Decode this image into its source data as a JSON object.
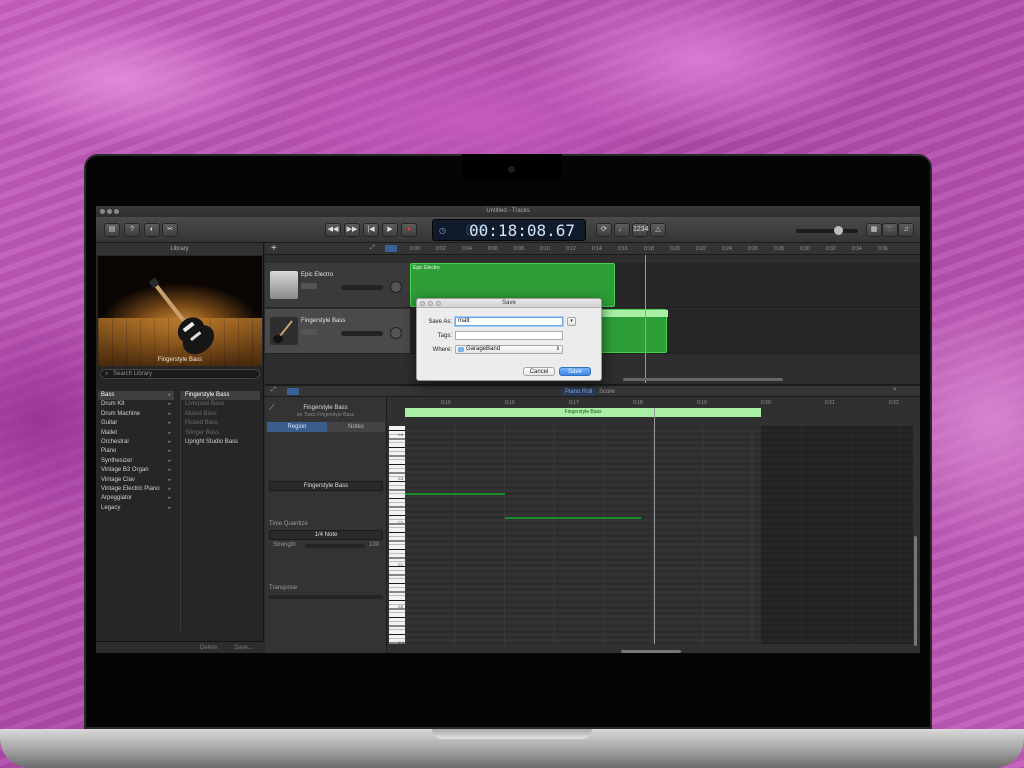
{
  "window": {
    "title": "Untitled - Tracks"
  },
  "transport": {
    "time": "00:18:08.67",
    "ghost": "00"
  },
  "library": {
    "header": "Library",
    "image_caption": "Fingerstyle Bass",
    "search_placeholder": "Search Library",
    "categories": [
      "Bass",
      "Drum Kit",
      "Drum Machine",
      "Guitar",
      "Mallet",
      "Orchestral",
      "Piano",
      "Synthesizer",
      "Vintage B3 Organ",
      "Vintage Clav",
      "Vintage Electric Piano",
      "Arpeggiator",
      "Legacy"
    ],
    "patches": [
      "Fingerstyle Bass",
      "Liverpool Bass",
      "Muted Bass",
      "Picked Bass",
      "Stinger Bass",
      "Upright Studio Bass"
    ],
    "footer_delete": "Delete",
    "footer_save": "Save..."
  },
  "ruler": [
    "0:00",
    "0:02",
    "0:04",
    "0:06",
    "0:08",
    "0:10",
    "0:12",
    "0:14",
    "0:16",
    "0:18",
    "0:20",
    "0:22",
    "0:24",
    "0:26",
    "0:28",
    "0:30",
    "0:32",
    "0:34",
    "0:36"
  ],
  "tracks": [
    {
      "name": "Epic Electro",
      "region": "Epic Electro"
    },
    {
      "name": "Fingerstyle Bass",
      "region": ""
    }
  ],
  "editor": {
    "tab_piano": "Piano Roll",
    "tab_score": "Score",
    "title": "Fingerstyle Bass",
    "subtitle": "on Track Fingerstyle Bass",
    "seg_region": "Region",
    "seg_notes": "Notes",
    "region_name": "Fingerstyle Bass",
    "time_quantize_label": "Time Quantize",
    "time_quantize_value": "1/4 Note",
    "strength_label": "Strength",
    "strength_value": "100",
    "transpose_label": "Transpose",
    "region_bar": "Fingerstyle Bass",
    "ruler": [
      "0:15",
      "0:16",
      "0:17",
      "0:18",
      "0:19",
      "0:20",
      "0:21",
      "0:22"
    ],
    "octaves": [
      "C4",
      "C3",
      "C2",
      "C1",
      "C0",
      "C-1"
    ]
  },
  "dialog": {
    "title": "Save",
    "save_as_label": "Save As:",
    "save_as_value": "matt",
    "tags_label": "Tags:",
    "tags_value": "",
    "where_label": "Where:",
    "where_value": "GarageBand",
    "cancel": "Cancel",
    "save": "Save"
  },
  "colors": {
    "region_green": "#2e9e37",
    "accent_blue": "#3c8ae6",
    "background": "#b84fb1"
  }
}
